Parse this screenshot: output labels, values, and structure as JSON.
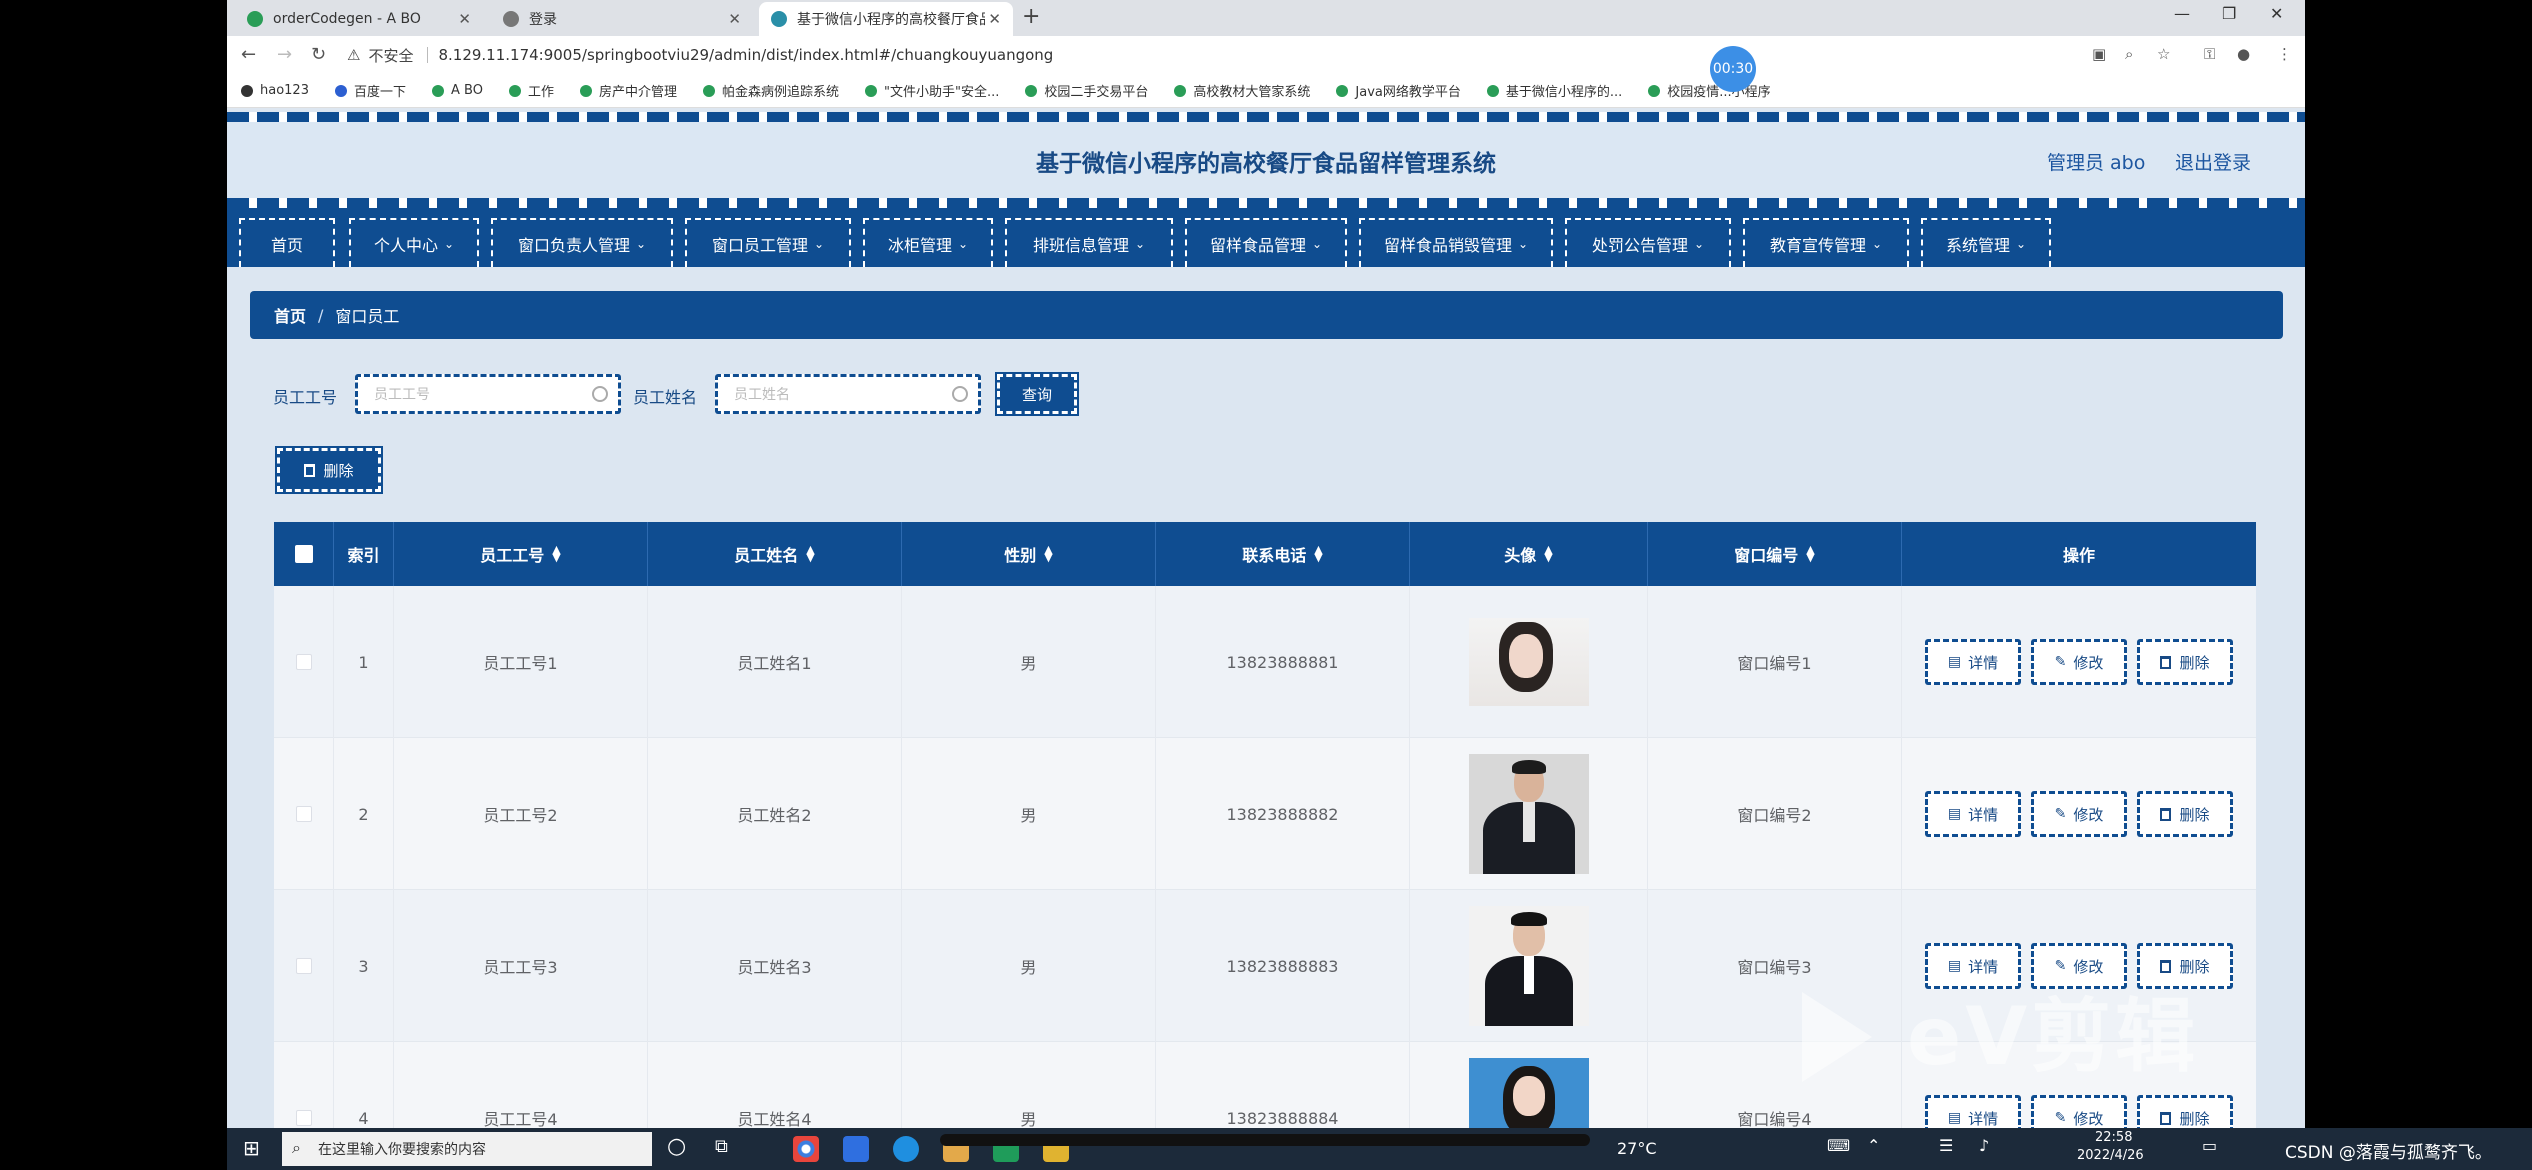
{
  "browser": {
    "tabs": [
      {
        "label": "orderCodegen - A BO",
        "color": "#2a9d57"
      },
      {
        "label": "登录",
        "color": "#777777"
      },
      {
        "label": "基于微信小程序的高校餐厅食品留",
        "color": "#2a8fa8"
      }
    ],
    "security": "不安全",
    "url": "8.129.11.174:9005/springbootviu29/admin/dist/index.html#/chuangkouyuangong",
    "timer": "00:30",
    "bookmarks": [
      "hao123",
      "百度一下",
      "A BO",
      "工作",
      "房产中介管理",
      "帕金森病例追踪系统",
      "\"文件小助手\"安全...",
      "校园二手交易平台",
      "高校教材大管家系统",
      "Java网络教学平台",
      "基于微信小程序的...",
      "校园疫情...小程序"
    ]
  },
  "header": {
    "title": "基于微信小程序的高校餐厅食品留样管理系统",
    "admin": "管理员 abo",
    "logout": "退出登录"
  },
  "menu": [
    "首页",
    "个人中心",
    "窗口负责人管理",
    "窗口员工管理",
    "冰柜管理",
    "排班信息管理",
    "留样食品管理",
    "留样食品销毁管理",
    "处罚公告管理",
    "教育宣传管理",
    "系统管理"
  ],
  "breadcrumb": {
    "home": "首页",
    "sep": "/",
    "current": "窗口员工"
  },
  "search": {
    "label1": "员工工号",
    "placeholder1": "员工工号",
    "label2": "员工姓名",
    "placeholder2": "员工姓名",
    "query": "查询",
    "delete": "删除"
  },
  "table": {
    "headers": [
      "索引",
      "员工工号",
      "员工姓名",
      "性别",
      "联系电话",
      "头像",
      "窗口编号",
      "操作"
    ],
    "rows": [
      {
        "index": "1",
        "id": "员工工号1",
        "name": "员工姓名1",
        "gender": "男",
        "phone": "13823888881",
        "window": "窗口编号1"
      },
      {
        "index": "2",
        "id": "员工工号2",
        "name": "员工姓名2",
        "gender": "男",
        "phone": "13823888882",
        "window": "窗口编号2"
      },
      {
        "index": "3",
        "id": "员工工号3",
        "name": "员工姓名3",
        "gender": "男",
        "phone": "13823888883",
        "window": "窗口编号3"
      },
      {
        "index": "4",
        "id": "员工工号4",
        "name": "员工姓名4",
        "gender": "男",
        "phone": "13823888884",
        "window": "窗口编号4"
      }
    ],
    "ops": {
      "detail": "详情",
      "edit": "修改",
      "delete": "删除"
    }
  },
  "watermark": "eV剪辑",
  "taskbar": {
    "search_placeholder": "在这里输入你要搜索的内容",
    "temperature": "27°C",
    "time": "22:58",
    "date": "2022/4/26",
    "credit": "CSDN @落霞与孤鹜齐飞。"
  }
}
